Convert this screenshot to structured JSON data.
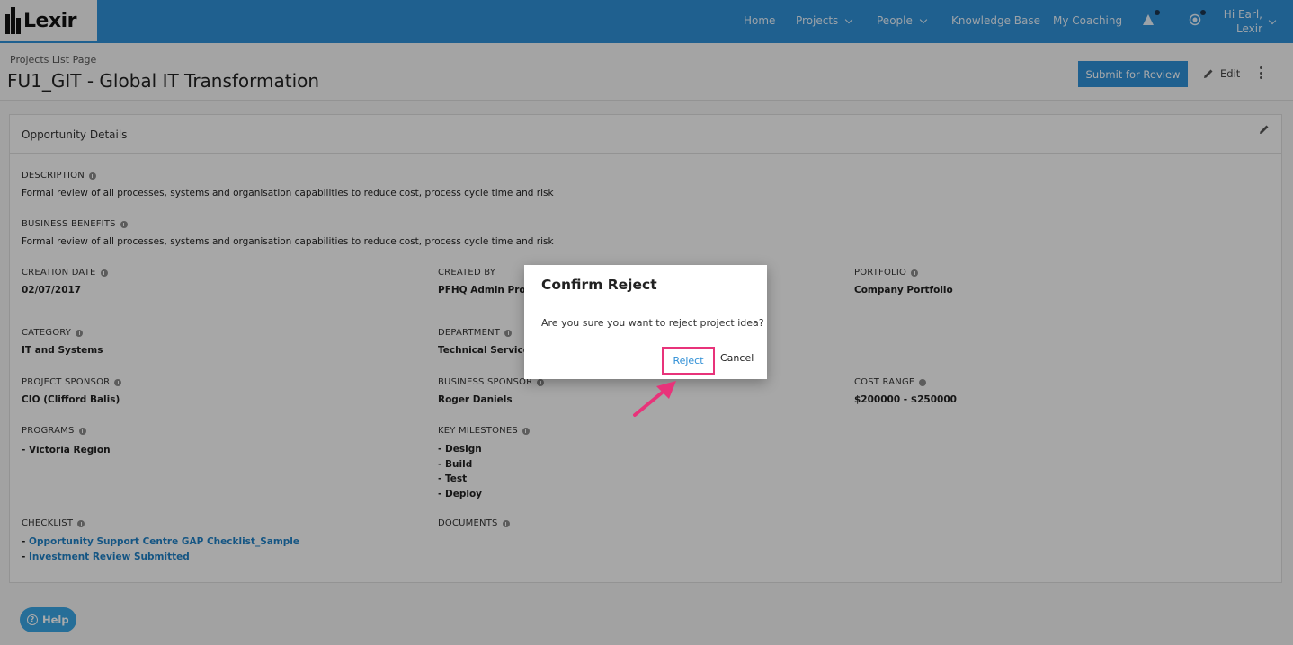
{
  "app": {
    "logo_text": "Lexir"
  },
  "nav": {
    "home": "Home",
    "projects": "Projects",
    "people": "People",
    "knowledge_base": "Knowledge Base",
    "my_coaching": "My Coaching",
    "greeting_line1": "Hi Earl,",
    "greeting_line2": "Lexir"
  },
  "header": {
    "breadcrumb": "Projects List Page",
    "title": "FU1_GIT - Global IT Transformation",
    "submit_label": "Submit for Review",
    "edit_label": "Edit"
  },
  "card": {
    "title": "Opportunity Details",
    "description_label": "DESCRIPTION",
    "description_value": "Formal review of all processes, systems and organisation capabilities to reduce cost, process cycle time and risk",
    "benefits_label": "BUSINESS BENEFITS",
    "benefits_value": "Formal review of all processes, systems and organisation capabilities to reduce cost, process cycle time and risk",
    "creation_date_label": "CREATION DATE",
    "creation_date_value": "02/07/2017",
    "created_by_label": "CREATED BY",
    "created_by_value": "PFHQ Admin Project",
    "portfolio_label": "PORTFOLIO",
    "portfolio_value": "Company Portfolio",
    "category_label": "CATEGORY",
    "category_value": "IT and Systems",
    "department_label": "DEPARTMENT",
    "department_value": "Technical Services",
    "project_sponsor_label": "PROJECT SPONSOR",
    "project_sponsor_value": "CIO (Clifford Balis)",
    "business_sponsor_label": "BUSINESS SPONSOR",
    "business_sponsor_value": "Roger Daniels",
    "cost_range_label": "COST RANGE",
    "cost_range_value": "$200000 - $250000",
    "programs_label": "PROGRAMS",
    "programs": [
      "- Victoria Region"
    ],
    "milestones_label": "KEY MILESTONES",
    "milestones": [
      "- Design",
      "- Build",
      "- Test",
      "- Deploy"
    ],
    "checklist_label": "CHECKLIST",
    "checklist": [
      "Opportunity Support Centre GAP Checklist_Sample",
      "Investment Review Submitted"
    ],
    "documents_label": "DOCUMENTS"
  },
  "modal": {
    "title": "Confirm Reject",
    "message": "Are you sure you want to reject project idea?",
    "reject_label": "Reject",
    "cancel_label": "Cancel"
  },
  "help": {
    "label": "Help"
  },
  "colors": {
    "primary": "#2f8fd6",
    "highlight": "#e8337a",
    "link": "#1f7fc4"
  }
}
